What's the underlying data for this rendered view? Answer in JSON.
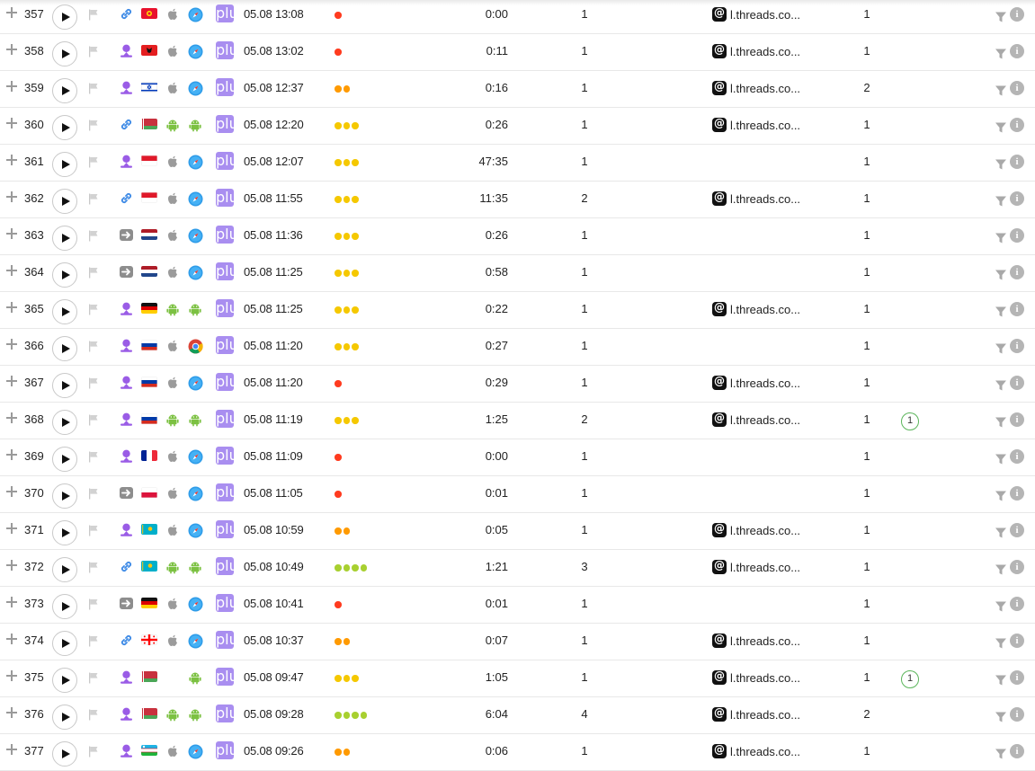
{
  "icons": {
    "expand": "plus-icon",
    "play": "play-icon",
    "flag": "flag-icon",
    "add": "plus",
    "filter": "filter-icon",
    "info": "i",
    "referrer": "threads-icon"
  },
  "colors": {
    "accent": "#a98ef0",
    "dot_red": "#ff3b1f",
    "dot_orange": "#ff9a00",
    "dot_yellow": "#f5c800",
    "dot_lime": "#a8d030",
    "goal_border": "#5bb55b"
  },
  "rows": [
    {
      "id": "357",
      "source": "link",
      "country": "kg",
      "os": "apple",
      "browser": "safari",
      "datetime": "05.08 13:08",
      "dots": 1,
      "dot_color": "red",
      "duration": "0:00",
      "pages": "1",
      "referrer": "l.threads.co...",
      "visits": "1",
      "goal": ""
    },
    {
      "id": "358",
      "source": "ad",
      "country": "al",
      "os": "apple",
      "browser": "safari",
      "datetime": "05.08 13:02",
      "dots": 1,
      "dot_color": "red",
      "duration": "0:11",
      "pages": "1",
      "referrer": "l.threads.co...",
      "visits": "1",
      "goal": ""
    },
    {
      "id": "359",
      "source": "ad",
      "country": "il",
      "os": "apple",
      "browser": "safari",
      "datetime": "05.08 12:37",
      "dots": 2,
      "dot_color": "orange",
      "duration": "0:16",
      "pages": "1",
      "referrer": "l.threads.co...",
      "visits": "2",
      "goal": ""
    },
    {
      "id": "360",
      "source": "link",
      "country": "by",
      "os": "android",
      "browser": "android",
      "datetime": "05.08 12:20",
      "dots": 3,
      "dot_color": "yellow",
      "duration": "0:26",
      "pages": "1",
      "referrer": "l.threads.co...",
      "visits": "1",
      "goal": ""
    },
    {
      "id": "361",
      "source": "ad",
      "country": "id",
      "os": "apple",
      "browser": "safari",
      "datetime": "05.08 12:07",
      "dots": 3,
      "dot_color": "yellow",
      "duration": "47:35",
      "pages": "1",
      "referrer": "",
      "visits": "1",
      "goal": ""
    },
    {
      "id": "362",
      "source": "link",
      "country": "id",
      "os": "apple",
      "browser": "safari",
      "datetime": "05.08 11:55",
      "dots": 3,
      "dot_color": "yellow",
      "duration": "11:35",
      "pages": "2",
      "referrer": "l.threads.co...",
      "visits": "1",
      "goal": ""
    },
    {
      "id": "363",
      "source": "direct",
      "country": "nl",
      "os": "apple",
      "browser": "safari",
      "datetime": "05.08 11:36",
      "dots": 3,
      "dot_color": "yellow",
      "duration": "0:26",
      "pages": "1",
      "referrer": "",
      "visits": "1",
      "goal": ""
    },
    {
      "id": "364",
      "source": "direct",
      "country": "nl",
      "os": "apple",
      "browser": "safari",
      "datetime": "05.08 11:25",
      "dots": 3,
      "dot_color": "yellow",
      "duration": "0:58",
      "pages": "1",
      "referrer": "",
      "visits": "1",
      "goal": ""
    },
    {
      "id": "365",
      "source": "ad",
      "country": "de",
      "os": "android",
      "browser": "android",
      "datetime": "05.08 11:25",
      "dots": 3,
      "dot_color": "yellow",
      "duration": "0:22",
      "pages": "1",
      "referrer": "l.threads.co...",
      "visits": "1",
      "goal": ""
    },
    {
      "id": "366",
      "source": "ad",
      "country": "ru",
      "os": "apple",
      "browser": "chrome",
      "datetime": "05.08 11:20",
      "dots": 3,
      "dot_color": "yellow",
      "duration": "0:27",
      "pages": "1",
      "referrer": "",
      "visits": "1",
      "goal": ""
    },
    {
      "id": "367",
      "source": "ad",
      "country": "ru",
      "os": "apple",
      "browser": "safari",
      "datetime": "05.08 11:20",
      "dots": 1,
      "dot_color": "red",
      "duration": "0:29",
      "pages": "1",
      "referrer": "l.threads.co...",
      "visits": "1",
      "goal": ""
    },
    {
      "id": "368",
      "source": "ad",
      "country": "ru",
      "os": "android",
      "browser": "android",
      "datetime": "05.08 11:19",
      "dots": 3,
      "dot_color": "yellow",
      "duration": "1:25",
      "pages": "2",
      "referrer": "l.threads.co...",
      "visits": "1",
      "goal": "1"
    },
    {
      "id": "369",
      "source": "ad",
      "country": "fr",
      "os": "apple",
      "browser": "safari",
      "datetime": "05.08 11:09",
      "dots": 1,
      "dot_color": "red",
      "duration": "0:00",
      "pages": "1",
      "referrer": "",
      "visits": "1",
      "goal": ""
    },
    {
      "id": "370",
      "source": "direct",
      "country": "pl",
      "os": "apple",
      "browser": "safari",
      "datetime": "05.08 11:05",
      "dots": 1,
      "dot_color": "red",
      "duration": "0:01",
      "pages": "1",
      "referrer": "",
      "visits": "1",
      "goal": ""
    },
    {
      "id": "371",
      "source": "ad",
      "country": "kz",
      "os": "apple",
      "browser": "safari",
      "datetime": "05.08 10:59",
      "dots": 2,
      "dot_color": "orange",
      "duration": "0:05",
      "pages": "1",
      "referrer": "l.threads.co...",
      "visits": "1",
      "goal": ""
    },
    {
      "id": "372",
      "source": "link",
      "country": "kz",
      "os": "android",
      "browser": "android",
      "datetime": "05.08 10:49",
      "dots": 4,
      "dot_color": "lime",
      "duration": "1:21",
      "pages": "3",
      "referrer": "l.threads.co...",
      "visits": "1",
      "goal": ""
    },
    {
      "id": "373",
      "source": "direct",
      "country": "de",
      "os": "apple",
      "browser": "safari",
      "datetime": "05.08 10:41",
      "dots": 1,
      "dot_color": "red",
      "duration": "0:01",
      "pages": "1",
      "referrer": "",
      "visits": "1",
      "goal": ""
    },
    {
      "id": "374",
      "source": "link",
      "country": "ge",
      "os": "apple",
      "browser": "safari",
      "datetime": "05.08 10:37",
      "dots": 2,
      "dot_color": "orange",
      "duration": "0:07",
      "pages": "1",
      "referrer": "l.threads.co...",
      "visits": "1",
      "goal": ""
    },
    {
      "id": "375",
      "source": "ad",
      "country": "by",
      "os": "",
      "browser": "android",
      "datetime": "05.08 09:47",
      "dots": 3,
      "dot_color": "yellow",
      "duration": "1:05",
      "pages": "1",
      "referrer": "l.threads.co...",
      "visits": "1",
      "goal": "1"
    },
    {
      "id": "376",
      "source": "ad",
      "country": "by",
      "os": "android",
      "browser": "android",
      "datetime": "05.08 09:28",
      "dots": 4,
      "dot_color": "lime",
      "duration": "6:04",
      "pages": "4",
      "referrer": "l.threads.co...",
      "visits": "2",
      "goal": ""
    },
    {
      "id": "377",
      "source": "ad",
      "country": "uz",
      "os": "apple",
      "browser": "safari",
      "datetime": "05.08 09:26",
      "dots": 2,
      "dot_color": "orange",
      "duration": "0:06",
      "pages": "1",
      "referrer": "l.threads.co...",
      "visits": "1",
      "goal": ""
    }
  ]
}
